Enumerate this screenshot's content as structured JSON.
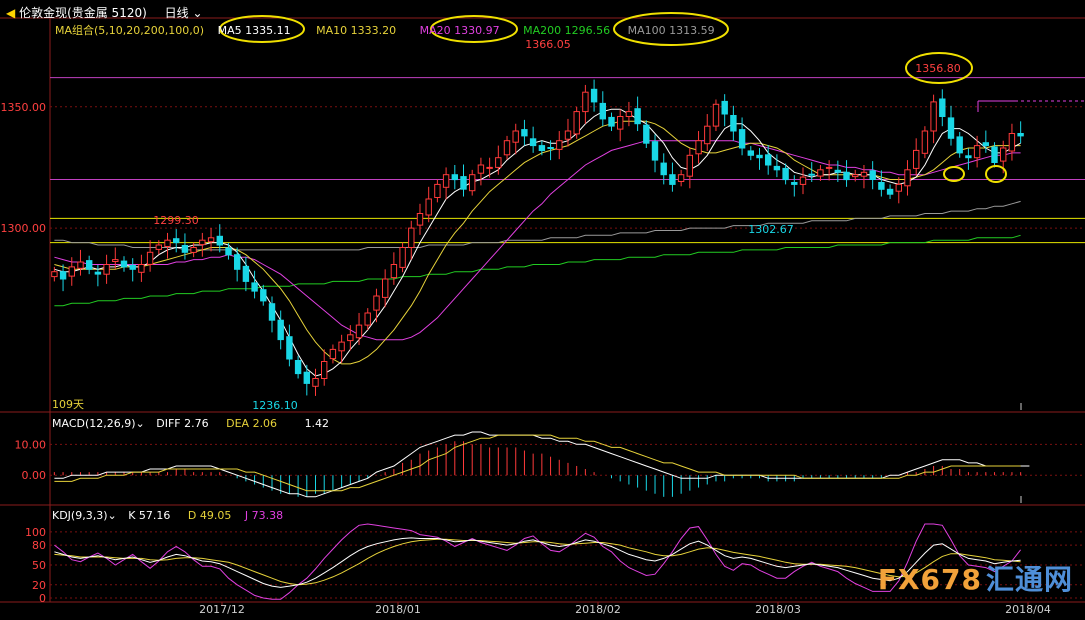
{
  "header": {
    "symbol": "伦敦金现(贵金属 5120)",
    "period": "日线",
    "ma_group": "MA组合(5,10,20,200,100,0)",
    "ma": [
      {
        "label": "MA5 1335.11",
        "color": "#ffffff"
      },
      {
        "label": "MA10 1333.20",
        "color": "#e6d23a"
      },
      {
        "label": "MA20 1330.97",
        "color": "#e040e0"
      },
      {
        "label": "MA200 1296.56",
        "color": "#22cc22"
      },
      {
        "label": "MA100 1313.59",
        "color": "#9a9a9a"
      }
    ]
  },
  "macd": {
    "title": "MACD(12,26,9)",
    "diff": "DIFF  2.76",
    "dea": "DEA  2.06",
    "macd": "1.42"
  },
  "kdj": {
    "title": "KDJ(9,3,3)",
    "k": "K   57.16",
    "d": "D   49.05",
    "j": "J   73.38"
  },
  "annotations": {
    "high_label": "1366.05",
    "high2_label": "1356.80",
    "low_label": "1236.10",
    "mid_low_label": "1302.67",
    "left_high_label": "1299.30",
    "days_label": "109天"
  },
  "watermark": {
    "fx": "FX678",
    "cn": "汇通网"
  },
  "colors": {
    "up": "#ff3a3a",
    "down": "#19d7e6",
    "grid": "#7a1010",
    "axis": "#8a1c1c",
    "hline_purple": "#c040c0",
    "hline_yellow": "#e6e600",
    "circle": "#f0e000"
  },
  "chart_data": {
    "type": "candlestick",
    "x_ticks": [
      "2017/12",
      "2018/01",
      "2018/02",
      "2018/03",
      "2018/04"
    ],
    "price_axis": {
      "ticks": [
        1300.0,
        1350.0
      ],
      "ylim": [
        1225,
        1380
      ]
    },
    "macd_axis": {
      "ticks": [
        0.0,
        10.0
      ],
      "ylim": [
        -9,
        14
      ]
    },
    "kdj_axis": {
      "ticks": [
        0,
        20,
        50,
        80,
        100
      ],
      "ylim": [
        -3,
        112
      ]
    },
    "horizontal_lines": [
      {
        "value": 1362,
        "color": "purple"
      },
      {
        "value": 1320,
        "color": "purple"
      },
      {
        "value": 1304,
        "color": "yellow"
      },
      {
        "value": 1294,
        "color": "yellow"
      }
    ],
    "candles_close": [
      1282,
      1279,
      1284,
      1286,
      1283,
      1281,
      1285,
      1287,
      1284,
      1283,
      1285,
      1290,
      1293,
      1295,
      1294,
      1290,
      1292,
      1295,
      1296,
      1293,
      1289,
      1283,
      1278,
      1274,
      1270,
      1262,
      1254,
      1246,
      1240,
      1236,
      1238,
      1245,
      1250,
      1253,
      1256,
      1260,
      1265,
      1272,
      1279,
      1285,
      1292,
      1300,
      1306,
      1312,
      1318,
      1322,
      1320,
      1316,
      1322,
      1326,
      1325,
      1329,
      1336,
      1340,
      1338,
      1334,
      1332,
      1333,
      1336,
      1340,
      1348,
      1356,
      1352,
      1345,
      1342,
      1346,
      1348,
      1343,
      1335,
      1328,
      1322,
      1318,
      1322,
      1330,
      1336,
      1342,
      1351,
      1347,
      1340,
      1333,
      1330,
      1329,
      1326,
      1324,
      1320,
      1318,
      1321,
      1322,
      1324,
      1325,
      1323,
      1320,
      1322,
      1323,
      1320,
      1316,
      1314,
      1318,
      1324,
      1332,
      1340,
      1352,
      1346,
      1337,
      1331,
      1329,
      1334,
      1334,
      1327,
      1333,
      1339,
      1338
    ],
    "ma5": [
      1283,
      1282,
      1282,
      1283,
      1284,
      1283,
      1284,
      1284,
      1285,
      1284,
      1284,
      1286,
      1289,
      1291,
      1292,
      1292,
      1293,
      1293,
      1294,
      1294,
      1293,
      1290,
      1285,
      1279,
      1274,
      1268,
      1262,
      1255,
      1248,
      1242,
      1239,
      1240,
      1242,
      1245,
      1250,
      1254,
      1258,
      1263,
      1268,
      1274,
      1280,
      1287,
      1294,
      1300,
      1306,
      1312,
      1315,
      1317,
      1319,
      1320,
      1322,
      1324,
      1328,
      1331,
      1334,
      1335,
      1336,
      1335,
      1335,
      1336,
      1339,
      1343,
      1346,
      1348,
      1349,
      1349,
      1347,
      1345,
      1343,
      1339,
      1335,
      1329,
      1325,
      1324,
      1326,
      1330,
      1336,
      1341,
      1343,
      1343,
      1340,
      1336,
      1331,
      1328,
      1326,
      1323,
      1322,
      1321,
      1322,
      1322,
      1323,
      1323,
      1322,
      1322,
      1322,
      1320,
      1319,
      1318,
      1319,
      1321,
      1326,
      1333,
      1339,
      1341,
      1341,
      1339,
      1336,
      1333,
      1331,
      1331,
      1333,
      1335
    ],
    "ma10": [
      1285,
      1284,
      1283,
      1283,
      1283,
      1283,
      1283,
      1283,
      1284,
      1284,
      1284,
      1285,
      1286,
      1287,
      1288,
      1289,
      1290,
      1291,
      1292,
      1292,
      1292,
      1291,
      1289,
      1286,
      1283,
      1279,
      1275,
      1270,
      1264,
      1258,
      1253,
      1249,
      1246,
      1244,
      1244,
      1245,
      1247,
      1250,
      1254,
      1258,
      1263,
      1268,
      1274,
      1281,
      1287,
      1293,
      1298,
      1302,
      1307,
      1311,
      1315,
      1318,
      1321,
      1324,
      1327,
      1329,
      1331,
      1332,
      1333,
      1334,
      1336,
      1338,
      1340,
      1342,
      1343,
      1344,
      1344,
      1344,
      1344,
      1343,
      1341,
      1338,
      1335,
      1333,
      1332,
      1331,
      1331,
      1332,
      1333,
      1334,
      1335,
      1335,
      1334,
      1333,
      1331,
      1328,
      1326,
      1324,
      1322,
      1322,
      1322,
      1322,
      1322,
      1322,
      1322,
      1321,
      1320,
      1320,
      1320,
      1321,
      1322,
      1324,
      1327,
      1330,
      1332,
      1333,
      1333,
      1333,
      1334,
      1334,
      1334,
      1334
    ],
    "ma20": [
      1288,
      1287,
      1286,
      1286,
      1285,
      1285,
      1285,
      1285,
      1285,
      1285,
      1285,
      1285,
      1285,
      1285,
      1286,
      1286,
      1287,
      1287,
      1288,
      1288,
      1289,
      1288,
      1288,
      1287,
      1285,
      1283,
      1281,
      1278,
      1275,
      1272,
      1269,
      1266,
      1263,
      1260,
      1258,
      1256,
      1255,
      1254,
      1254,
      1254,
      1254,
      1255,
      1257,
      1260,
      1263,
      1267,
      1271,
      1275,
      1279,
      1283,
      1287,
      1291,
      1295,
      1299,
      1303,
      1307,
      1310,
      1314,
      1317,
      1320,
      1323,
      1326,
      1328,
      1330,
      1332,
      1333,
      1334,
      1335,
      1336,
      1336,
      1336,
      1336,
      1336,
      1336,
      1336,
      1336,
      1336,
      1336,
      1336,
      1335,
      1335,
      1334,
      1333,
      1332,
      1331,
      1330,
      1329,
      1328,
      1327,
      1326,
      1326,
      1325,
      1325,
      1324,
      1324,
      1323,
      1323,
      1322,
      1322,
      1322,
      1322,
      1323,
      1324,
      1325,
      1326,
      1327,
      1328,
      1329,
      1330,
      1330,
      1331,
      1331
    ],
    "ma200": [
      1268,
      1268,
      1269,
      1269,
      1269,
      1270,
      1270,
      1270,
      1271,
      1271,
      1271,
      1272,
      1272,
      1272,
      1273,
      1273,
      1273,
      1274,
      1274,
      1274,
      1275,
      1275,
      1275,
      1275,
      1276,
      1276,
      1276,
      1276,
      1277,
      1277,
      1277,
      1277,
      1278,
      1278,
      1278,
      1278,
      1279,
      1279,
      1279,
      1279,
      1280,
      1280,
      1280,
      1281,
      1281,
      1281,
      1282,
      1282,
      1282,
      1283,
      1283,
      1283,
      1284,
      1284,
      1284,
      1285,
      1285,
      1285,
      1285,
      1286,
      1286,
      1286,
      1287,
      1287,
      1287,
      1287,
      1288,
      1288,
      1288,
      1288,
      1289,
      1289,
      1289,
      1289,
      1290,
      1290,
      1290,
      1290,
      1290,
      1291,
      1291,
      1291,
      1291,
      1291,
      1292,
      1292,
      1292,
      1292,
      1292,
      1292,
      1293,
      1293,
      1293,
      1293,
      1293,
      1293,
      1294,
      1294,
      1294,
      1294,
      1294,
      1295,
      1295,
      1295,
      1295,
      1295,
      1296,
      1296,
      1296,
      1296,
      1296,
      1297
    ],
    "ma100": [
      1295,
      1295,
      1294,
      1294,
      1294,
      1293,
      1293,
      1293,
      1293,
      1292,
      1292,
      1292,
      1292,
      1292,
      1292,
      1291,
      1291,
      1291,
      1291,
      1291,
      1291,
      1291,
      1291,
      1291,
      1291,
      1291,
      1291,
      1291,
      1291,
      1291,
      1291,
      1291,
      1291,
      1291,
      1291,
      1291,
      1292,
      1292,
      1292,
      1292,
      1292,
      1292,
      1292,
      1293,
      1293,
      1293,
      1293,
      1293,
      1294,
      1294,
      1294,
      1294,
      1295,
      1295,
      1295,
      1295,
      1295,
      1296,
      1296,
      1296,
      1296,
      1297,
      1297,
      1297,
      1297,
      1298,
      1298,
      1298,
      1298,
      1299,
      1299,
      1299,
      1299,
      1300,
      1300,
      1300,
      1300,
      1300,
      1301,
      1301,
      1301,
      1301,
      1302,
      1302,
      1302,
      1302,
      1302,
      1303,
      1303,
      1303,
      1303,
      1303,
      1304,
      1304,
      1304,
      1304,
      1305,
      1305,
      1305,
      1305,
      1306,
      1306,
      1306,
      1307,
      1307,
      1307,
      1308,
      1308,
      1309,
      1309,
      1310,
      1311
    ],
    "macd_hist": [
      1,
      1,
      1,
      1,
      1,
      1,
      1,
      1,
      1,
      1,
      1,
      1,
      1,
      1,
      2,
      2,
      1,
      1,
      1,
      1,
      0,
      -1,
      -2,
      -3,
      -4,
      -5,
      -6,
      -6,
      -7,
      -7,
      -6,
      -6,
      -5,
      -4,
      -3,
      -2,
      -1,
      0,
      1,
      2,
      4,
      5,
      7,
      8,
      9,
      10,
      11,
      11,
      10,
      10,
      9,
      9,
      9,
      9,
      8,
      7,
      7,
      6,
      5,
      4,
      3,
      2,
      1,
      0,
      -1,
      -2,
      -3,
      -4,
      -5,
      -6,
      -7,
      -7,
      -6,
      -5,
      -4,
      -3,
      -2,
      -2,
      -1,
      -1,
      -1,
      -1,
      -2,
      -2,
      -2,
      -2,
      -1,
      -1,
      -1,
      -1,
      -1,
      -1,
      -1,
      -1,
      -1,
      -1,
      0,
      0,
      1,
      1,
      2,
      3,
      3,
      2,
      2,
      1,
      1,
      1,
      1,
      1,
      1,
      1
    ],
    "macd_diff": [
      -1,
      -1,
      0,
      0,
      0,
      0,
      1,
      1,
      1,
      1,
      1,
      2,
      2,
      2,
      3,
      3,
      3,
      3,
      3,
      2,
      1,
      0,
      -1,
      -2,
      -3,
      -4,
      -5,
      -6,
      -6,
      -7,
      -7,
      -6,
      -5,
      -4,
      -3,
      -2,
      -1,
      1,
      2,
      3,
      5,
      7,
      9,
      10,
      11,
      12,
      13,
      13,
      14,
      14,
      13,
      13,
      13,
      13,
      13,
      13,
      12,
      12,
      11,
      11,
      10,
      10,
      9,
      8,
      7,
      6,
      5,
      4,
      3,
      2,
      1,
      0,
      -1,
      -1,
      -1,
      -1,
      0,
      0,
      0,
      0,
      0,
      0,
      -1,
      -1,
      -1,
      -1,
      -1,
      -1,
      -1,
      -1,
      -1,
      -1,
      -1,
      -1,
      -1,
      -1,
      0,
      0,
      1,
      2,
      3,
      4,
      5,
      5,
      5,
      4,
      4,
      3,
      3,
      3,
      3,
      3,
      3
    ],
    "macd_dea": [
      -2,
      -2,
      -2,
      -1,
      -1,
      -1,
      0,
      0,
      0,
      1,
      1,
      1,
      1,
      2,
      2,
      2,
      2,
      2,
      2,
      2,
      2,
      2,
      1,
      1,
      0,
      -1,
      -2,
      -3,
      -4,
      -5,
      -5,
      -5,
      -5,
      -5,
      -4,
      -4,
      -3,
      -2,
      -1,
      0,
      1,
      2,
      3,
      5,
      6,
      7,
      9,
      10,
      11,
      12,
      12,
      13,
      13,
      13,
      13,
      13,
      13,
      13,
      12,
      12,
      12,
      11,
      11,
      10,
      9,
      9,
      8,
      7,
      6,
      5,
      4,
      4,
      3,
      2,
      1,
      1,
      1,
      0,
      0,
      0,
      0,
      0,
      0,
      0,
      0,
      0,
      -1,
      -1,
      -1,
      -1,
      -1,
      -1,
      -1,
      -1,
      -1,
      -1,
      -1,
      -1,
      0,
      0,
      1,
      1,
      2,
      3,
      3,
      3,
      3,
      3,
      3,
      3,
      3,
      3
    ],
    "kdj_k": [
      70,
      66,
      62,
      60,
      62,
      64,
      61,
      58,
      60,
      62,
      58,
      54,
      57,
      62,
      66,
      64,
      60,
      56,
      55,
      52,
      46,
      40,
      34,
      28,
      22,
      18,
      16,
      18,
      20,
      24,
      30,
      38,
      46,
      55,
      64,
      72,
      78,
      82,
      85,
      88,
      90,
      91,
      90,
      90,
      90,
      88,
      85,
      86,
      88,
      86,
      84,
      82,
      80,
      82,
      86,
      88,
      84,
      80,
      78,
      80,
      84,
      88,
      86,
      82,
      78,
      72,
      66,
      62,
      58,
      56,
      60,
      66,
      74,
      82,
      86,
      80,
      72,
      64,
      60,
      62,
      60,
      56,
      52,
      48,
      46,
      48,
      50,
      52,
      50,
      48,
      46,
      42,
      38,
      34,
      30,
      28,
      26,
      30,
      40,
      54,
      68,
      80,
      82,
      74,
      66,
      60,
      58,
      56,
      52,
      54,
      56,
      57
    ],
    "kdj_d": [
      66,
      65,
      64,
      62,
      62,
      62,
      62,
      61,
      60,
      60,
      60,
      58,
      57,
      58,
      60,
      61,
      61,
      60,
      58,
      56,
      54,
      50,
      45,
      40,
      35,
      30,
      25,
      22,
      20,
      21,
      23,
      27,
      32,
      38,
      45,
      52,
      60,
      67,
      73,
      78,
      82,
      85,
      87,
      88,
      89,
      89,
      88,
      87,
      87,
      87,
      86,
      85,
      84,
      83,
      84,
      85,
      85,
      84,
      82,
      81,
      82,
      83,
      84,
      84,
      82,
      80,
      76,
      73,
      70,
      66,
      64,
      64,
      66,
      70,
      74,
      76,
      75,
      72,
      69,
      67,
      65,
      63,
      60,
      57,
      54,
      52,
      51,
      51,
      51,
      50,
      49,
      48,
      46,
      43,
      40,
      37,
      34,
      32,
      33,
      38,
      46,
      55,
      63,
      67,
      67,
      65,
      63,
      61,
      58,
      57,
      56,
      55
    ],
    "kdj_j": [
      80,
      70,
      58,
      55,
      62,
      68,
      60,
      50,
      58,
      66,
      55,
      45,
      56,
      70,
      78,
      70,
      58,
      48,
      48,
      44,
      30,
      20,
      12,
      4,
      0,
      -2,
      -2,
      8,
      20,
      30,
      44,
      60,
      74,
      88,
      100,
      110,
      112,
      110,
      108,
      106,
      104,
      102,
      96,
      94,
      92,
      86,
      78,
      84,
      90,
      84,
      80,
      76,
      72,
      80,
      90,
      94,
      82,
      72,
      70,
      78,
      88,
      98,
      92,
      78,
      70,
      56,
      46,
      40,
      34,
      36,
      52,
      70,
      90,
      106,
      108,
      88,
      66,
      48,
      42,
      52,
      50,
      42,
      36,
      30,
      30,
      40,
      48,
      54,
      48,
      44,
      40,
      30,
      22,
      16,
      10,
      10,
      10,
      26,
      54,
      86,
      112,
      112,
      110,
      88,
      64,
      50,
      48,
      46,
      40,
      48,
      56,
      73
    ]
  }
}
